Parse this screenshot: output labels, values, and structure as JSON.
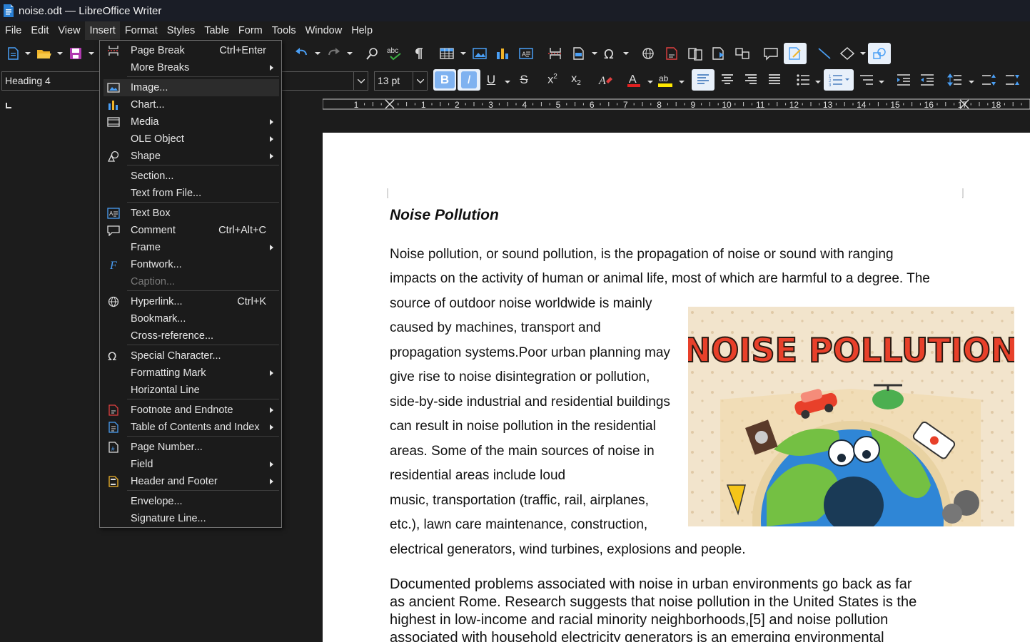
{
  "window": {
    "title": "noise.odt — LibreOffice Writer"
  },
  "menubar": {
    "items": [
      "File",
      "Edit",
      "View",
      "Insert",
      "Format",
      "Styles",
      "Table",
      "Form",
      "Tools",
      "Window",
      "Help"
    ]
  },
  "formatting": {
    "paragraph_style": "Heading 4",
    "font_size": "13 pt"
  },
  "ruler": {
    "labels": [
      "1",
      "1",
      "2",
      "3",
      "4",
      "5",
      "6",
      "7",
      "8",
      "9",
      "10",
      "11",
      "12",
      "13",
      "14",
      "15",
      "16",
      "17",
      "18"
    ]
  },
  "insert_menu": {
    "items": [
      {
        "label": "Page Break",
        "shortcut": "Ctrl+Enter",
        "icon": "page-break-icon"
      },
      {
        "label": "More Breaks",
        "submenu": true
      },
      {
        "label": "Image...",
        "icon": "image-icon",
        "highlighted": true
      },
      {
        "label": "Chart...",
        "icon": "chart-icon"
      },
      {
        "label": "Media",
        "icon": "media-icon",
        "submenu": true
      },
      {
        "label": "OLE Object",
        "submenu": true
      },
      {
        "label": "Shape",
        "icon": "shape-icon",
        "submenu": true
      },
      {
        "label": "Section..."
      },
      {
        "label": "Text from File..."
      },
      {
        "label": "Text Box",
        "icon": "text-box-icon"
      },
      {
        "label": "Comment",
        "shortcut": "Ctrl+Alt+C",
        "icon": "comment-icon"
      },
      {
        "label": "Frame",
        "submenu": true
      },
      {
        "label": "Fontwork...",
        "icon": "fontwork-icon"
      },
      {
        "label": "Caption...",
        "disabled": true
      },
      {
        "label": "Hyperlink...",
        "shortcut": "Ctrl+K",
        "icon": "hyperlink-icon"
      },
      {
        "label": "Bookmark..."
      },
      {
        "label": "Cross-reference..."
      },
      {
        "label": "Special Character...",
        "icon": "special-character-icon"
      },
      {
        "label": "Formatting Mark",
        "submenu": true
      },
      {
        "label": "Horizontal Line"
      },
      {
        "label": "Footnote and Endnote",
        "icon": "footnote-icon",
        "submenu": true
      },
      {
        "label": "Table of Contents and Index",
        "icon": "toc-icon",
        "submenu": true
      },
      {
        "label": "Page Number...",
        "icon": "page-number-icon"
      },
      {
        "label": "Field",
        "submenu": true
      },
      {
        "label": "Header and Footer",
        "icon": "header-footer-icon",
        "submenu": true
      },
      {
        "label": "Envelope..."
      },
      {
        "label": "Signature Line..."
      }
    ]
  },
  "document": {
    "heading": "Noise Pollution",
    "para1_lines": [
      "Noise pollution, or sound pollution, is the propagation of noise or sound with ranging",
      "impacts on the activity of human or animal life, most of which are harmful to a degree. The",
      "source of outdoor noise worldwide is mainly",
      "caused by machines, transport and",
      "propagation systems.Poor urban planning may",
      "give rise to noise disintegration or pollution,",
      "side-by-side industrial and residential buildings",
      "can result in noise pollution in the residential",
      "areas. Some of the main sources of noise in",
      "residential areas include loud",
      "music, transportation (traffic, rail, airplanes,",
      "etc.), lawn care maintenance, construction,",
      "electrical generators, wind turbines, explosions and people."
    ],
    "para2_lines": [
      "Documented problems associated with noise in urban environments go back as far",
      "as ancient Rome. Research suggests that noise pollution in the United States is the",
      "highest in low-income and racial minority neighborhoods,[5] and noise pollution",
      "associated with household electricity generators is an emerging environmental"
    ],
    "image_text": "NOISE POLLUTION"
  }
}
